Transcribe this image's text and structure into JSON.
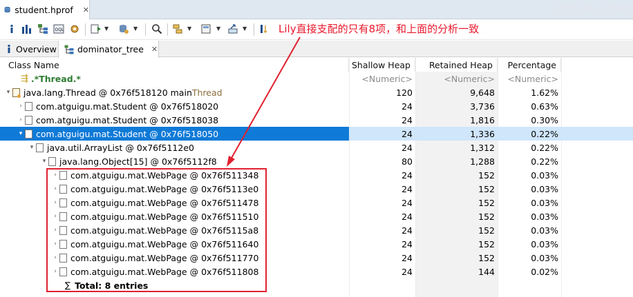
{
  "editor_tab": {
    "title": "student.hprof",
    "close": "✕"
  },
  "watermark": "DDKK.COM",
  "annotation": "Lily直接支配的只有8项，和上面的分析一致",
  "view_tabs": [
    {
      "label": "Overview"
    },
    {
      "label": "dominator_tree"
    }
  ],
  "columns": {
    "name": "Class Name",
    "shallow": "Shallow Heap",
    "retained": "Retained Heap",
    "percentage": "Percentage"
  },
  "filter_row": {
    "regex": ".*Thread.*",
    "shallow": "<Numeric>",
    "retained": "<Numeric>",
    "percentage": "<Numeric>"
  },
  "rows": [
    {
      "name": "java.lang.Thread @ 0x76f518120  main ",
      "suffix": "Thread",
      "shallow": "120",
      "retained": "9,648",
      "percentage": "1.62%"
    },
    {
      "name": "com.atguigu.mat.Student @ 0x76f518020",
      "shallow": "24",
      "retained": "3,736",
      "percentage": "0.63%"
    },
    {
      "name": "com.atguigu.mat.Student @ 0x76f518038",
      "shallow": "24",
      "retained": "1,816",
      "percentage": "0.30%"
    },
    {
      "name": "com.atguigu.mat.Student @ 0x76f518050",
      "shallow": "24",
      "retained": "1,336",
      "percentage": "0.22%"
    },
    {
      "name": "java.util.ArrayList @ 0x76f5112e0",
      "shallow": "24",
      "retained": "1,312",
      "percentage": "0.22%"
    },
    {
      "name": "java.lang.Object[15] @ 0x76f5112f8",
      "shallow": "80",
      "retained": "1,288",
      "percentage": "0.22%"
    },
    {
      "name": "com.atguigu.mat.WebPage @ 0x76f511348",
      "shallow": "24",
      "retained": "152",
      "percentage": "0.03%"
    },
    {
      "name": "com.atguigu.mat.WebPage @ 0x76f5113e0",
      "shallow": "24",
      "retained": "152",
      "percentage": "0.03%"
    },
    {
      "name": "com.atguigu.mat.WebPage @ 0x76f511478",
      "shallow": "24",
      "retained": "152",
      "percentage": "0.03%"
    },
    {
      "name": "com.atguigu.mat.WebPage @ 0x76f511510",
      "shallow": "24",
      "retained": "152",
      "percentage": "0.03%"
    },
    {
      "name": "com.atguigu.mat.WebPage @ 0x76f5115a8",
      "shallow": "24",
      "retained": "152",
      "percentage": "0.03%"
    },
    {
      "name": "com.atguigu.mat.WebPage @ 0x76f511640",
      "shallow": "24",
      "retained": "152",
      "percentage": "0.03%"
    },
    {
      "name": "com.atguigu.mat.WebPage @ 0x76f511770",
      "shallow": "24",
      "retained": "152",
      "percentage": "0.03%"
    },
    {
      "name": "com.atguigu.mat.WebPage @ 0x76f511808",
      "shallow": "24",
      "retained": "144",
      "percentage": "0.02%"
    }
  ],
  "total": "Total: 8 entries",
  "colors": {
    "selection": "#0f7ad7",
    "annotation": "#e8192c",
    "regex": "#2e7d32"
  }
}
